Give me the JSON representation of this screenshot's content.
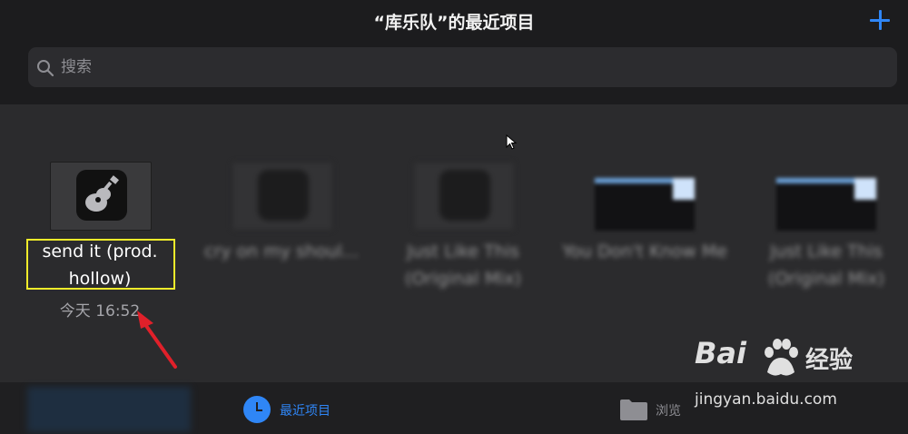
{
  "header": {
    "title": "“库乐队”的最近项目",
    "add_icon": "plus-icon",
    "accent": "#2f86f6"
  },
  "search": {
    "placeholder": "搜索",
    "icon": "search-icon"
  },
  "projects": [
    {
      "name": "send it (prod. hollow)",
      "date": "今天 16:52",
      "icon": "guitar-icon",
      "blurred": false
    },
    {
      "name": "cry on my shoul...",
      "date": "",
      "icon": "guitar-icon",
      "blurred": true
    },
    {
      "name": "Just Like This (Original Mix)",
      "date": "",
      "icon": "guitar-icon",
      "blurred": true
    },
    {
      "name": "You Don't Know Me",
      "date": "",
      "icon": "document-icon",
      "blurred": true
    },
    {
      "name": "Just Like This (Original Mix)",
      "date": "",
      "icon": "document-icon",
      "blurred": true
    }
  ],
  "tabbar": {
    "recent_label": "最近项目",
    "recent_icon": "clock-icon",
    "browse_label": "浏览",
    "browse_icon": "folder-icon"
  },
  "watermark": {
    "logo": "Bai",
    "logo_cn": "经验",
    "url": "jingyan.baidu.com"
  },
  "annotation": {
    "highlight_color": "#f1ec2a",
    "arrow_color": "#e0202a"
  }
}
